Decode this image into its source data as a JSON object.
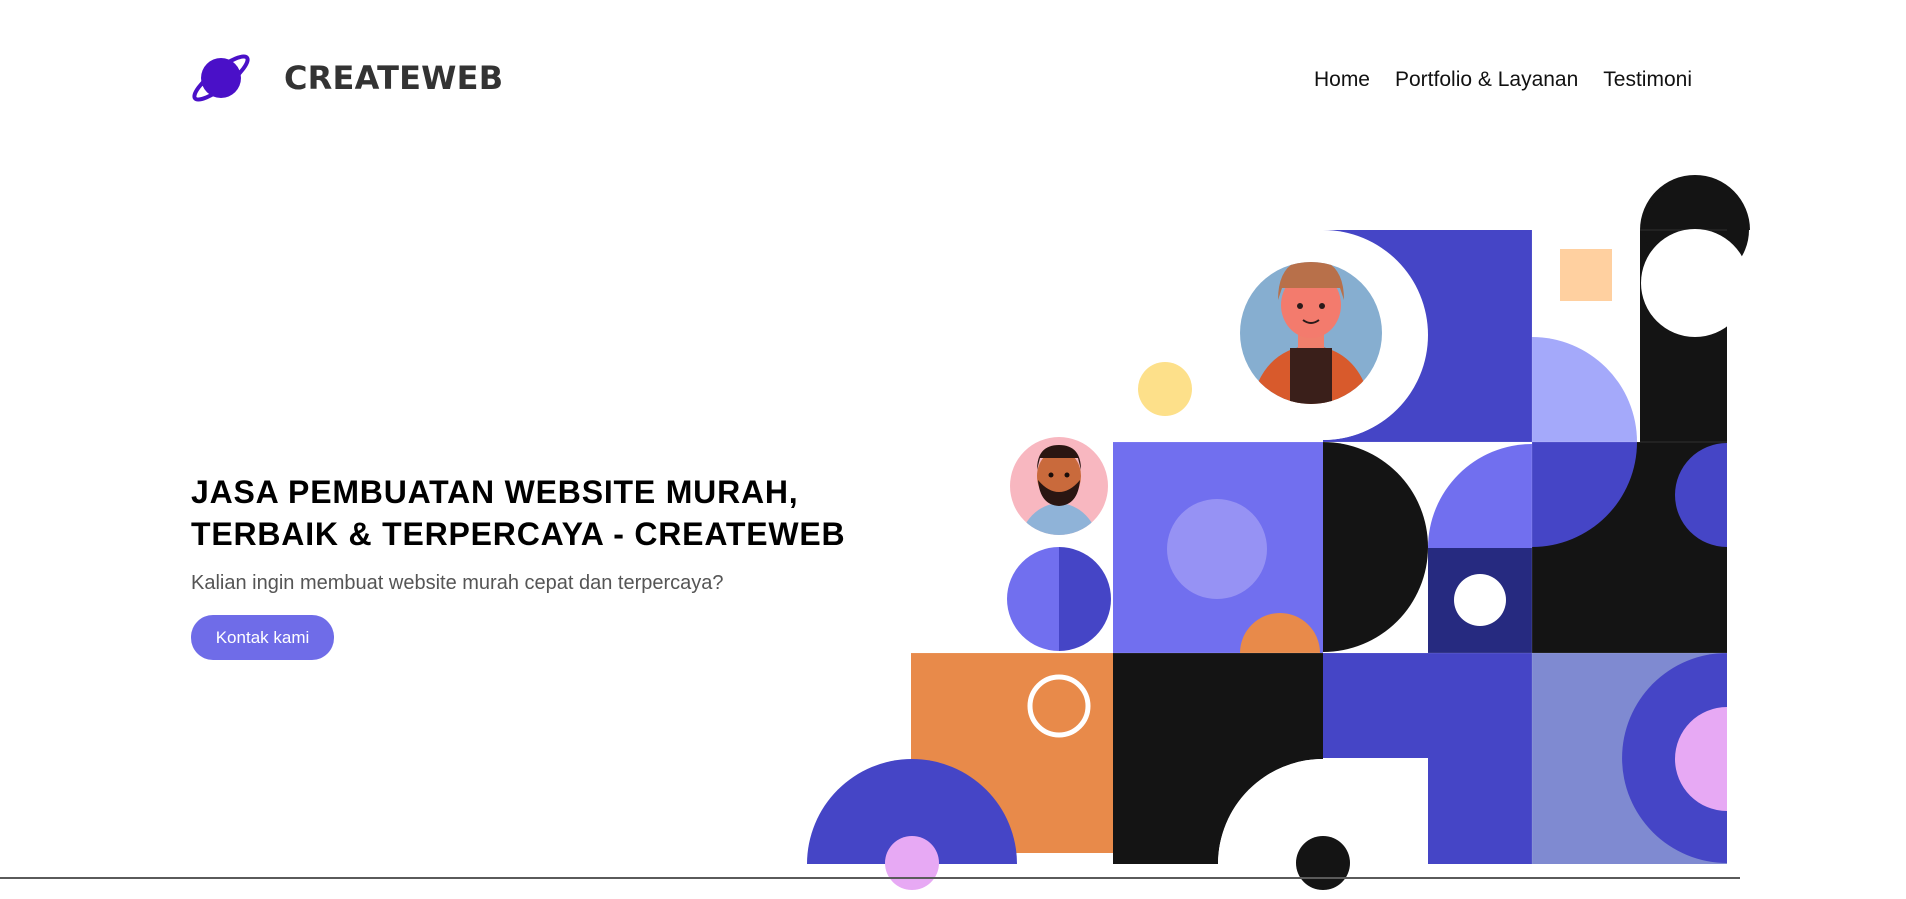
{
  "header": {
    "brand": "CREATEWEB",
    "logo_icon": "planet-icon",
    "nav": [
      {
        "label": "Home"
      },
      {
        "label": "Portfolio & Layanan"
      },
      {
        "label": "Testimoni"
      }
    ]
  },
  "hero": {
    "title_line1": "JASA PEMBUATAN WEBSITE MURAH,",
    "title_line2": "TERBAIK & TERPERCAYA - CREATEWEB",
    "subtitle": "Kalian ingin membuat website murah cepat dan terpercaya?",
    "cta_label": "Kontak kami"
  },
  "colors": {
    "accent": "#6f6ce8",
    "indigo": "#4545c6",
    "black": "#141414",
    "orange": "#e88a4a",
    "brand_purple": "#4a10c8"
  }
}
